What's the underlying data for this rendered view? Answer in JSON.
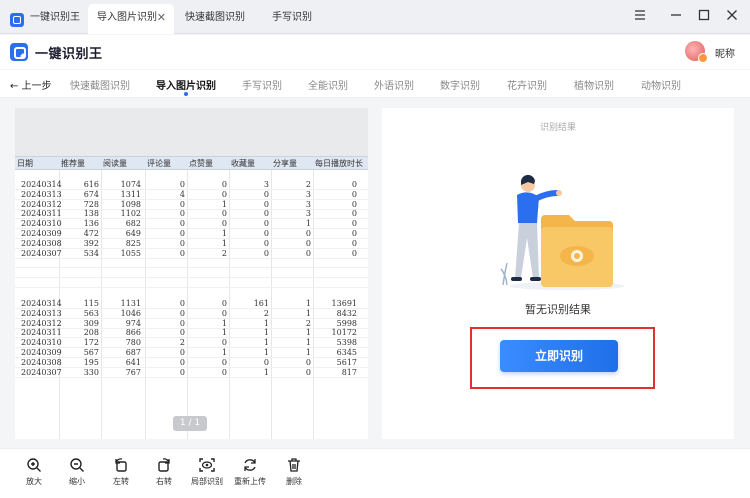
{
  "window": {
    "tabs": [
      {
        "label": "一键识别王"
      },
      {
        "label": "导入图片识别"
      },
      {
        "label": "快速截图识别"
      },
      {
        "label": "手写识别"
      }
    ],
    "close_glyph": "✕"
  },
  "header": {
    "brand": "一键识别王",
    "nickname": "昵称"
  },
  "subnav": {
    "back_label": "← 上一步",
    "tabs": [
      "快速截图识别",
      "导入图片识别",
      "手写识别",
      "全能识别",
      "外语识别",
      "数字识别",
      "花卉识别",
      "植物识别",
      "动物识别"
    ],
    "active_index": 1
  },
  "preview": {
    "columns": [
      "日期",
      "推荐量",
      "阅读量",
      "评论量",
      "点赞量",
      "收藏量",
      "分享量",
      "每日播放时长"
    ],
    "rows_top": [
      [
        "20240314",
        "616",
        "1074",
        "0",
        "0",
        "3",
        "2",
        "0"
      ],
      [
        "20240313",
        "674",
        "1311",
        "4",
        "0",
        "0",
        "3",
        "0"
      ],
      [
        "20240312",
        "728",
        "1098",
        "0",
        "1",
        "0",
        "3",
        "0"
      ],
      [
        "20240311",
        "138",
        "1102",
        "0",
        "0",
        "0",
        "3",
        "0"
      ],
      [
        "20240310",
        "136",
        "682",
        "0",
        "0",
        "0",
        "1",
        "0"
      ],
      [
        "20240309",
        "472",
        "649",
        "0",
        "1",
        "0",
        "0",
        "0"
      ],
      [
        "20240308",
        "392",
        "825",
        "0",
        "1",
        "0",
        "0",
        "0"
      ],
      [
        "20240307",
        "534",
        "1055",
        "0",
        "2",
        "0",
        "0",
        "0"
      ]
    ],
    "rows_bottom": [
      [
        "20240314",
        "115",
        "1131",
        "0",
        "0",
        "161",
        "1",
        "13691"
      ],
      [
        "20240313",
        "563",
        "1046",
        "0",
        "0",
        "2",
        "1",
        "8432"
      ],
      [
        "20240312",
        "309",
        "974",
        "0",
        "1",
        "1",
        "2",
        "5998"
      ],
      [
        "20240311",
        "208",
        "866",
        "0",
        "1",
        "1",
        "1",
        "10172"
      ],
      [
        "20240310",
        "172",
        "780",
        "2",
        "0",
        "1",
        "1",
        "5398"
      ],
      [
        "20240309",
        "567",
        "687",
        "0",
        "1",
        "1",
        "1",
        "6345"
      ],
      [
        "20240308",
        "195",
        "641",
        "0",
        "0",
        "0",
        "0",
        "5617"
      ],
      [
        "20240307",
        "330",
        "767",
        "0",
        "0",
        "1",
        "0",
        "817"
      ]
    ],
    "page_indicator": "1 / 1"
  },
  "result": {
    "title": "识别结果",
    "empty_text": "暂无识别结果",
    "button_label": "立即识别",
    "accent_color": "#2b6ff0",
    "highlight_color": "#e0302f"
  },
  "toolbar": {
    "items": [
      {
        "label": "放大",
        "icon": "zoom-in-icon"
      },
      {
        "label": "缩小",
        "icon": "zoom-out-icon"
      },
      {
        "label": "左转",
        "icon": "rotate-left-icon"
      },
      {
        "label": "右转",
        "icon": "rotate-right-icon"
      },
      {
        "label": "局部识别",
        "icon": "partial-scan-icon"
      },
      {
        "label": "重新上传",
        "icon": "reupload-icon"
      },
      {
        "label": "删除",
        "icon": "trash-icon"
      }
    ]
  }
}
